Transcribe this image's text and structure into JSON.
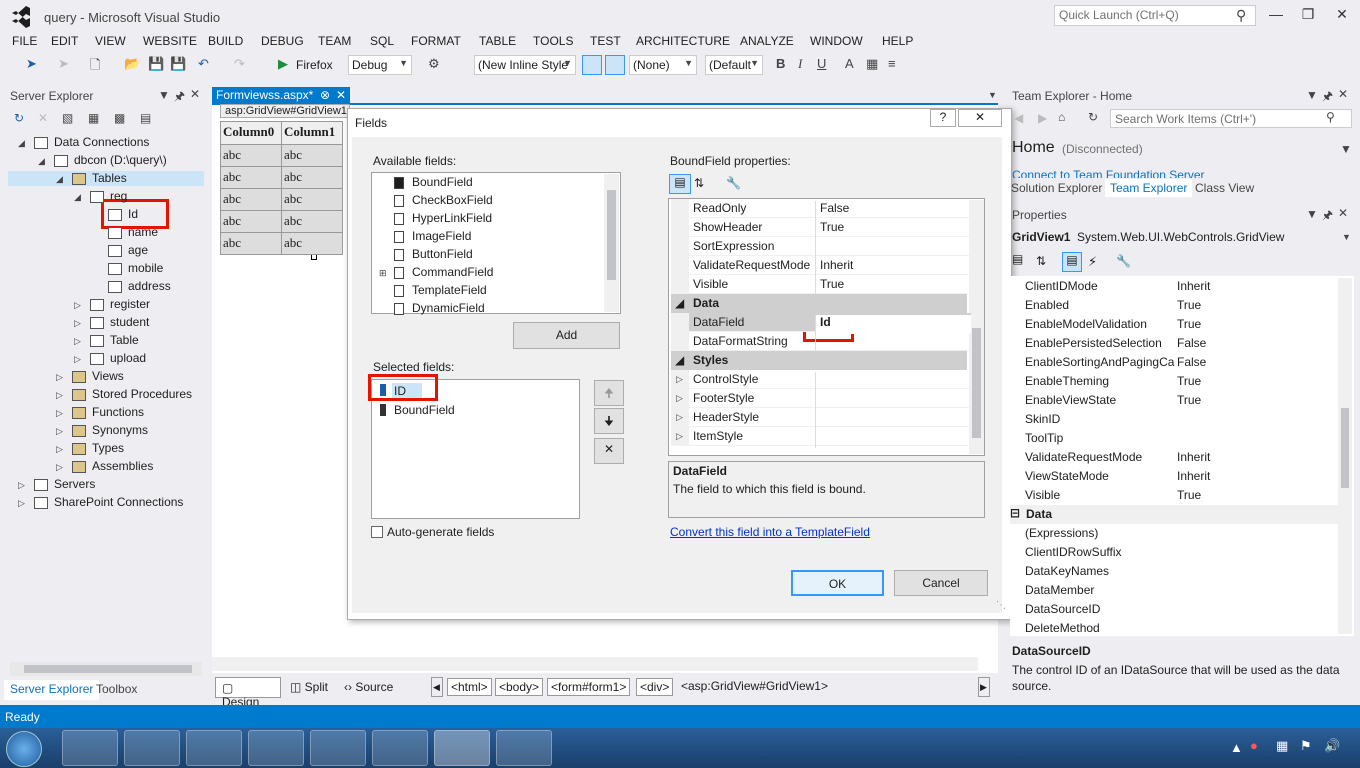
{
  "app": {
    "title": "query - Microsoft Visual Studio",
    "quick_launch": "Quick Launch (Ctrl+Q)"
  },
  "menu": [
    "FILE",
    "EDIT",
    "VIEW",
    "WEBSITE",
    "BUILD",
    "DEBUG",
    "TEAM",
    "SQL",
    "FORMAT",
    "TABLE",
    "TOOLS",
    "TEST",
    "ARCHITECTURE",
    "ANALYZE",
    "WINDOW",
    "HELP"
  ],
  "toolbar": {
    "browser": "Firefox",
    "config": "Debug",
    "style": "(New Inline Style",
    "target": "(None)",
    "font": "(Default",
    "bold": "B",
    "italic": "I",
    "underline": "U"
  },
  "server_explorer": {
    "title": "Server Explorer",
    "tree": [
      {
        "label": "Data Connections",
        "level": 1
      },
      {
        "label": "dbcon (D:\\query\\)",
        "level": 2
      },
      {
        "label": "Tables",
        "level": 3
      },
      {
        "label": "reg",
        "level": 4
      },
      {
        "label": "Id",
        "level": 5
      },
      {
        "label": "name",
        "level": 5
      },
      {
        "label": "age",
        "level": 5
      },
      {
        "label": "mobile",
        "level": 5
      },
      {
        "label": "address",
        "level": 5
      },
      {
        "label": "register",
        "level": 4
      },
      {
        "label": "student",
        "level": 4
      },
      {
        "label": "Table",
        "level": 4
      },
      {
        "label": "upload",
        "level": 4
      },
      {
        "label": "Views",
        "level": 3
      },
      {
        "label": "Stored Procedures",
        "level": 3
      },
      {
        "label": "Functions",
        "level": 3
      },
      {
        "label": "Synonyms",
        "level": 3
      },
      {
        "label": "Types",
        "level": 3
      },
      {
        "label": "Assemblies",
        "level": 3
      },
      {
        "label": "Servers",
        "level": 1
      },
      {
        "label": "SharePoint Connections",
        "level": 1
      }
    ],
    "tabs": [
      "Server Explorer",
      "Toolbox"
    ]
  },
  "editor": {
    "tab": "Formviewss.aspx*",
    "tag_label": "asp:GridView#GridView1",
    "columns": [
      "Column0",
      "Column1"
    ],
    "cell": "abc",
    "view_tabs": [
      "Design",
      "Split",
      "Source"
    ],
    "breadcrumbs": [
      "<html>",
      "<body>",
      "<form#form1>",
      "<div>",
      "<asp:GridView#GridView1>"
    ]
  },
  "dialog": {
    "title": "Fields",
    "help": "?",
    "close": "✕",
    "available_label": "Available fields:",
    "available": [
      "BoundField",
      "CheckBoxField",
      "HyperLinkField",
      "ImageField",
      "ButtonField",
      "CommandField",
      "TemplateField",
      "DynamicField"
    ],
    "add": "Add",
    "selected_label": "Selected fields:",
    "selected": [
      "ID",
      "BoundField"
    ],
    "autogen": "Auto-generate fields",
    "props_label": "BoundField properties:",
    "props": [
      {
        "k": "ReadOnly",
        "v": "False"
      },
      {
        "k": "ShowHeader",
        "v": "True"
      },
      {
        "k": "SortExpression",
        "v": ""
      },
      {
        "k": "ValidateRequestMode",
        "v": "Inherit"
      },
      {
        "k": "Visible",
        "v": "True"
      }
    ],
    "cat_data": "Data",
    "props_data": [
      {
        "k": "DataField",
        "v": "Id"
      },
      {
        "k": "DataFormatString",
        "v": ""
      }
    ],
    "cat_styles": "Styles",
    "props_styles": [
      {
        "k": "ControlStyle",
        "v": ""
      },
      {
        "k": "FooterStyle",
        "v": ""
      },
      {
        "k": "HeaderStyle",
        "v": ""
      },
      {
        "k": "ItemStyle",
        "v": ""
      }
    ],
    "desc_title": "DataField",
    "desc": "The field to which this field is bound.",
    "convert_link": "Convert this field into a TemplateField",
    "ok": "OK",
    "cancel": "Cancel"
  },
  "team": {
    "title": "Team Explorer - Home",
    "search": "Search Work Items (Ctrl+')",
    "home": "Home",
    "status": "(Disconnected)",
    "connect": "Connect to Team Foundation Server",
    "tabs": [
      "Solution Explorer",
      "Team Explorer",
      "Class View"
    ]
  },
  "properties": {
    "title": "Properties",
    "object": "GridView1",
    "type": "System.Web.UI.WebControls.GridView",
    "rows": [
      {
        "k": "ClientIDMode",
        "v": "Inherit"
      },
      {
        "k": "Enabled",
        "v": "True"
      },
      {
        "k": "EnableModelValidation",
        "v": "True"
      },
      {
        "k": "EnablePersistedSelection",
        "v": "False"
      },
      {
        "k": "EnableSortingAndPagingCal",
        "v": "False"
      },
      {
        "k": "EnableTheming",
        "v": "True"
      },
      {
        "k": "EnableViewState",
        "v": "True"
      },
      {
        "k": "SkinID",
        "v": ""
      },
      {
        "k": "ToolTip",
        "v": ""
      },
      {
        "k": "ValidateRequestMode",
        "v": "Inherit"
      },
      {
        "k": "ViewStateMode",
        "v": "Inherit"
      },
      {
        "k": "Visible",
        "v": "True"
      }
    ],
    "cat_data": "Data",
    "rows_data": [
      {
        "k": "(Expressions)",
        "v": ""
      },
      {
        "k": "ClientIDRowSuffix",
        "v": ""
      },
      {
        "k": "DataKeyNames",
        "v": ""
      },
      {
        "k": "DataMember",
        "v": ""
      },
      {
        "k": "DataSourceID",
        "v": ""
      },
      {
        "k": "DeleteMethod",
        "v": ""
      }
    ],
    "desc_title": "DataSourceID",
    "desc": "The control ID of an IDataSource that will be used as the data source."
  },
  "status": "Ready",
  "colors": {
    "accent": "#007acc",
    "highlight": "#e51400"
  }
}
